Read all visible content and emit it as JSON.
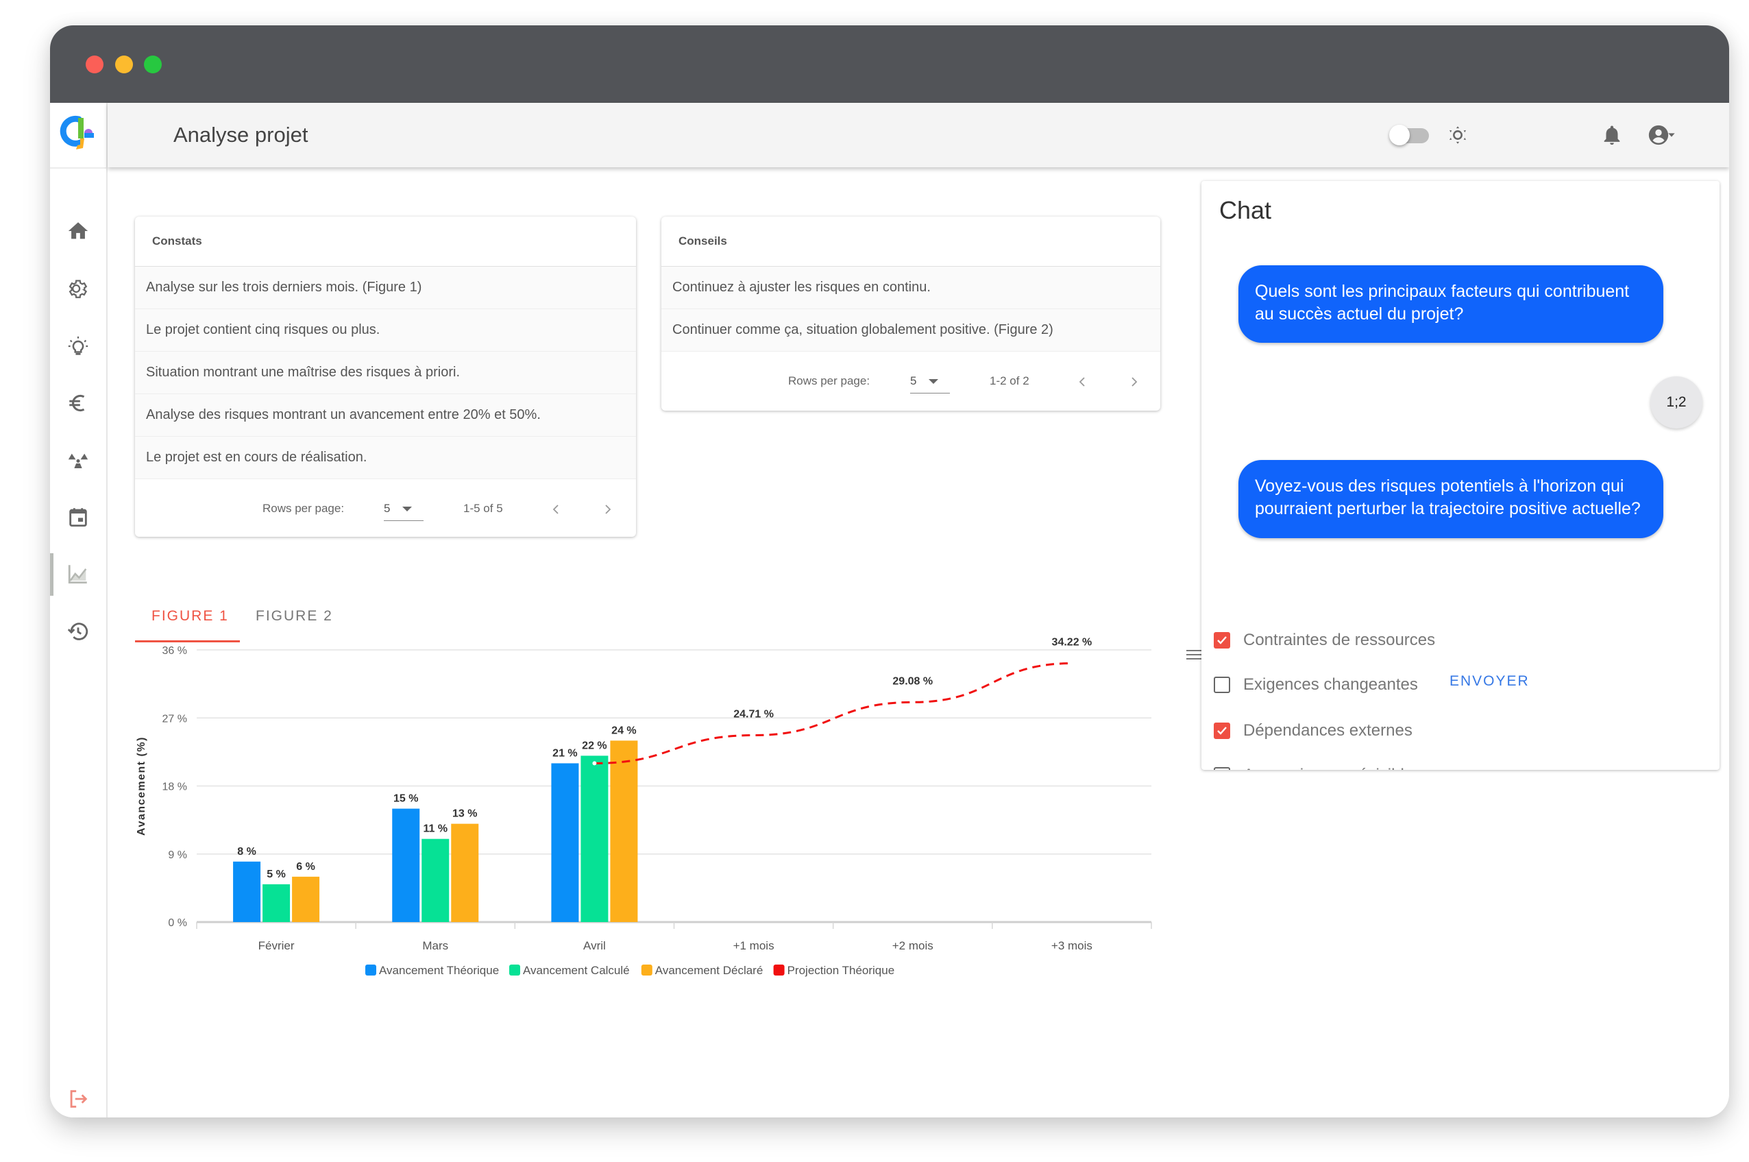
{
  "window": {
    "controls": [
      "close",
      "minimize",
      "maximize"
    ]
  },
  "header": {
    "title": "Analyse projet",
    "theme_toggle_on": false,
    "icons": [
      "logo",
      "theme-toggle",
      "brightness-icon",
      "bell-icon",
      "account-circle-icon",
      "caret-down-icon"
    ]
  },
  "sidebar": {
    "items": [
      {
        "name": "home",
        "icon": "home-icon"
      },
      {
        "name": "settings",
        "icon": "gear-icon"
      },
      {
        "name": "ideas",
        "icon": "lightbulb-icon"
      },
      {
        "name": "finance",
        "icon": "euro-icon"
      },
      {
        "name": "risks",
        "icon": "radiation-icon"
      },
      {
        "name": "calendar",
        "icon": "calendar-icon"
      },
      {
        "name": "analysis",
        "icon": "chart-icon",
        "active": true
      },
      {
        "name": "history",
        "icon": "history-icon"
      }
    ],
    "logout_icon": "logout-icon"
  },
  "constats": {
    "title": "Constats",
    "rows": [
      "Analyse sur les trois derniers mois. (Figure 1)",
      "Le projet contient cinq risques ou plus.",
      "Situation montrant une maîtrise des risques à priori.",
      "Analyse des risques montrant un avancement entre 20% et 50%.",
      "Le projet est en cours de réalisation."
    ],
    "pager": {
      "rows_per_page_label": "Rows per page:",
      "rows_per_page": "5",
      "range": "1-5 of 5"
    }
  },
  "conseils": {
    "title": "Conseils",
    "rows": [
      "Continuez à ajuster les risques en continu.",
      "Continuer comme ça, situation globalement positive. (Figure 2)"
    ],
    "pager": {
      "rows_per_page_label": "Rows per page:",
      "rows_per_page": "5",
      "range": "1-2 of 2"
    }
  },
  "tabs": [
    {
      "label": "FIGURE 1",
      "active": true
    },
    {
      "label": "FIGURE 2",
      "active": false
    }
  ],
  "chat": {
    "title": "Chat",
    "messages": [
      "Quels sont les principaux facteurs qui contribuent au succès actuel du projet?",
      "Voyez-vous des risques potentiels à l'horizon qui pourraient perturber la trajectoire positive actuelle?"
    ],
    "counter": "1;2",
    "options": [
      {
        "label": "Contraintes de ressources",
        "checked": true
      },
      {
        "label": "Exigences changeantes",
        "checked": false
      },
      {
        "label": "Dépendances externes",
        "checked": true
      },
      {
        "label": "Aucun risque prévisible",
        "checked": false
      }
    ],
    "send_label": "ENVOYER",
    "bubble_color": "#1064fb",
    "check_color": "#ef4f42"
  },
  "chart_data": {
    "type": "bar",
    "title": "",
    "xlabel": "",
    "ylabel": "Avancement (%)",
    "ylim": [
      0,
      36
    ],
    "yticks": [
      0,
      9,
      18,
      27,
      36
    ],
    "ytick_labels": [
      "0 %",
      "9 %",
      "18 %",
      "27 %",
      "36 %"
    ],
    "grid": true,
    "legend_position": "bottom",
    "categories": [
      "Février",
      "Mars",
      "Avril",
      "+1 mois",
      "+2 mois",
      "+3 mois"
    ],
    "series": [
      {
        "name": "Avancement Théorique",
        "type": "bar",
        "color": "#0a8ff8",
        "values": [
          8,
          15,
          21,
          null,
          null,
          null
        ],
        "labels": [
          "8 %",
          "15 %",
          "21 %",
          null,
          null,
          null
        ]
      },
      {
        "name": "Avancement Calculé",
        "type": "bar",
        "color": "#06e195",
        "values": [
          5,
          11,
          22,
          null,
          null,
          null
        ],
        "labels": [
          "5 %",
          "11 %",
          "22 %",
          null,
          null,
          null
        ]
      },
      {
        "name": "Avancement Déclaré",
        "type": "bar",
        "color": "#fdaf1b",
        "values": [
          6,
          13,
          24,
          null,
          null,
          null
        ],
        "labels": [
          "6 %",
          "13 %",
          "24 %",
          null,
          null,
          null
        ]
      },
      {
        "name": "Projection Théorique",
        "type": "line",
        "style": "dashed",
        "color": "#f10f0f",
        "values": [
          null,
          null,
          21,
          24.71,
          29.08,
          34.22
        ],
        "labels": [
          null,
          null,
          null,
          "24.71 %",
          "29.08 %",
          "34.22 %"
        ]
      }
    ]
  }
}
